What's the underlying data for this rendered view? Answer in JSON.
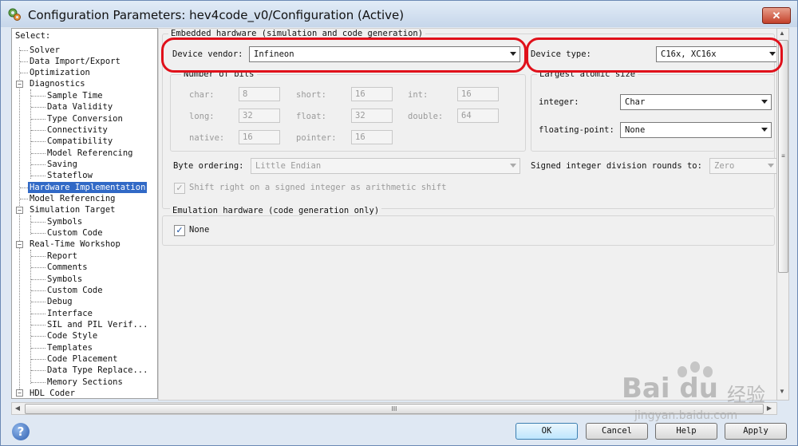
{
  "window": {
    "title": "Configuration Parameters: hev4code_v0/Configuration (Active)",
    "close_label": "✕"
  },
  "tree": {
    "header": "Select:",
    "items": [
      {
        "label": "Solver"
      },
      {
        "label": "Data Import/Export"
      },
      {
        "label": "Optimization"
      },
      {
        "label": "Diagnostics"
      },
      {
        "label": "Sample Time"
      },
      {
        "label": "Data Validity"
      },
      {
        "label": "Type Conversion"
      },
      {
        "label": "Connectivity"
      },
      {
        "label": "Compatibility"
      },
      {
        "label": "Model Referencing"
      },
      {
        "label": "Saving"
      },
      {
        "label": "Stateflow"
      },
      {
        "label": "Hardware Implementation"
      },
      {
        "label": "Model Referencing"
      },
      {
        "label": "Simulation Target"
      },
      {
        "label": "Symbols"
      },
      {
        "label": "Custom Code"
      },
      {
        "label": "Real-Time Workshop"
      },
      {
        "label": "Report"
      },
      {
        "label": "Comments"
      },
      {
        "label": "Symbols"
      },
      {
        "label": "Custom Code"
      },
      {
        "label": "Debug"
      },
      {
        "label": "Interface"
      },
      {
        "label": "SIL and PIL Verif..."
      },
      {
        "label": "Code Style"
      },
      {
        "label": "Templates"
      },
      {
        "label": "Code Placement"
      },
      {
        "label": "Data Type Replace..."
      },
      {
        "label": "Memory Sections"
      },
      {
        "label": "HDL Coder"
      }
    ],
    "selected": "Hardware Implementation",
    "expander_minus": "−"
  },
  "embedded": {
    "group_label": "Embedded hardware (simulation and code generation)",
    "device_vendor_label": "Device vendor:",
    "device_vendor_value": "Infineon",
    "device_type_label": "Device type:",
    "device_type_value": "C16x, XC16x",
    "bits": {
      "group_label": "Number of bits",
      "char_label": "char:",
      "char_value": "8",
      "short_label": "short:",
      "short_value": "16",
      "int_label": "int:",
      "int_value": "16",
      "long_label": "long:",
      "long_value": "32",
      "float_label": "float:",
      "float_value": "32",
      "double_label": "double:",
      "double_value": "64",
      "native_label": "native:",
      "native_value": "16",
      "pointer_label": "pointer:",
      "pointer_value": "16"
    },
    "atomic": {
      "group_label": "Largest atomic size",
      "integer_label": "integer:",
      "integer_value": "Char",
      "floating_label": "floating-point:",
      "floating_value": "None"
    },
    "byte_ordering_label": "Byte ordering:",
    "byte_ordering_value": "Little Endian",
    "signed_div_label": "Signed integer division rounds to:",
    "signed_div_value": "Zero",
    "shift_right_label": "Shift right on a signed integer as arithmetic shift",
    "shift_right_checked": true
  },
  "emulation": {
    "group_label": "Emulation hardware (code generation only)",
    "none_label": "None",
    "none_checked": true
  },
  "check_mark": "✓",
  "scroll": {
    "thumb_grip": "III",
    "vthumb_grip": "≡",
    "left": "◀",
    "right": "▶",
    "up": "▲",
    "down": "▼"
  },
  "buttons": {
    "help_icon": "?",
    "ok": "OK",
    "cancel": "Cancel",
    "help": "Help",
    "apply": "Apply"
  },
  "watermark": {
    "main": "Bai du",
    "cn": "经验",
    "url": "jingyan.baidu.com"
  },
  "colors": {
    "highlight_red": "#e0101a",
    "selection_blue": "#3169c6"
  }
}
